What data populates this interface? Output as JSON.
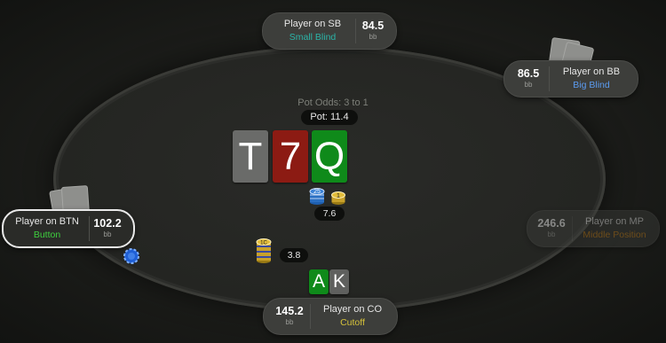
{
  "table": {
    "pot_odds": "Pot Odds: 3 to 1",
    "pot": "Pot: 11.4"
  },
  "board": [
    "T",
    "7",
    "Q"
  ],
  "hero_cards": [
    "A",
    "K"
  ],
  "bets": {
    "sb_chip_25": "25",
    "sb_chip_1": "1",
    "bb_bet": "7.6",
    "btn_chip_1c": "1C",
    "btn_bet": "3.8"
  },
  "seats": {
    "sb": {
      "name": "Player on SB",
      "position": "Small Blind",
      "stack": "84.5",
      "unit": "bb"
    },
    "bb": {
      "name": "Player on BB",
      "position": "Big Blind",
      "stack": "86.5",
      "unit": "bb"
    },
    "btn": {
      "name": "Player on BTN",
      "position": "Button",
      "stack": "102.2",
      "unit": "bb"
    },
    "mp": {
      "name": "Player on MP",
      "position": "Middle Position",
      "stack": "246.6",
      "unit": "bb"
    },
    "co": {
      "name": "Player on CO",
      "position": "Cutoff",
      "stack": "145.2",
      "unit": "bb"
    }
  },
  "colors": {
    "small_blind": "#2bb5a8",
    "big_blind": "#5b9bf0",
    "button": "#3ecf3e",
    "middle_position": "#d38a1f",
    "cutoff": "#d6c23b",
    "card_gray": "#6a6b69",
    "card_red": "#8c1b13",
    "card_green": "#0f8a1a"
  },
  "icons": [
    "chip-stack-icon",
    "dealer-button-icon",
    "card-back-icon"
  ]
}
